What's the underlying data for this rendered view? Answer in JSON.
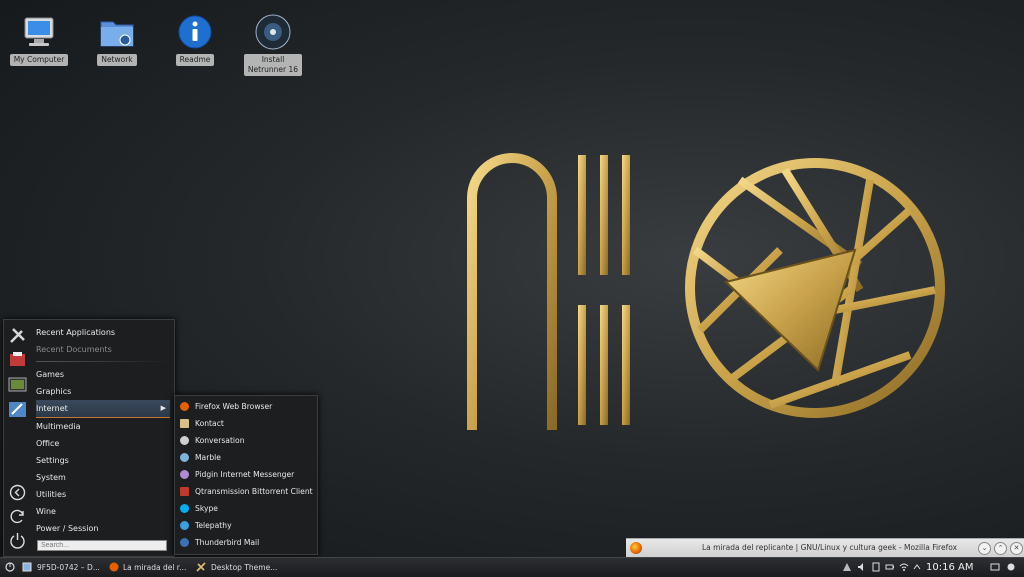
{
  "desktop": {
    "icons": [
      {
        "label": "My Computer",
        "icon": "computer-icon"
      },
      {
        "label": "Network",
        "icon": "network-folder-icon"
      },
      {
        "label": "Readme",
        "icon": "info-icon"
      },
      {
        "label_line1": "Install",
        "label_line2": "Netrunner 16",
        "icon": "install-disc-icon"
      }
    ]
  },
  "start_menu": {
    "items": [
      {
        "label": "Recent Applications"
      },
      {
        "label": "Recent Documents"
      },
      {
        "label": "Games"
      },
      {
        "label": "Graphics"
      },
      {
        "label": "Internet"
      },
      {
        "label": "Multimedia"
      },
      {
        "label": "Office"
      },
      {
        "label": "Settings"
      },
      {
        "label": "System"
      },
      {
        "label": "Utilities"
      },
      {
        "label": "Wine"
      },
      {
        "label": "Power / Session"
      }
    ],
    "search_placeholder": "Search..."
  },
  "internet_submenu": {
    "items": [
      {
        "label": "Firefox Web Browser",
        "color": "#e66000"
      },
      {
        "label": "Kontact",
        "color": "#d9c08a"
      },
      {
        "label": "Konversation",
        "color": "#cfcfcf"
      },
      {
        "label": "Marble",
        "color": "#7fb2d9"
      },
      {
        "label": "Pidgin Internet Messenger",
        "color": "#b08ad0"
      },
      {
        "label": "Qtransmission Bittorrent Client",
        "color": "#c0392b"
      },
      {
        "label": "Skype",
        "color": "#00aff0"
      },
      {
        "label": "Telepathy",
        "color": "#3aa0e0"
      },
      {
        "label": "Thunderbird Mail",
        "color": "#3b6fb6"
      }
    ]
  },
  "firefox_notification": {
    "title": "La mirada del replicante | GNU/Linux y cultura geek - Mozilla Firefox"
  },
  "taskbar": {
    "tasks": [
      {
        "label": "9F5D-0742 – D..."
      },
      {
        "label": "La mirada del r..."
      },
      {
        "label": "Desktop Theme..."
      }
    ],
    "clock": "10:16 AM"
  }
}
